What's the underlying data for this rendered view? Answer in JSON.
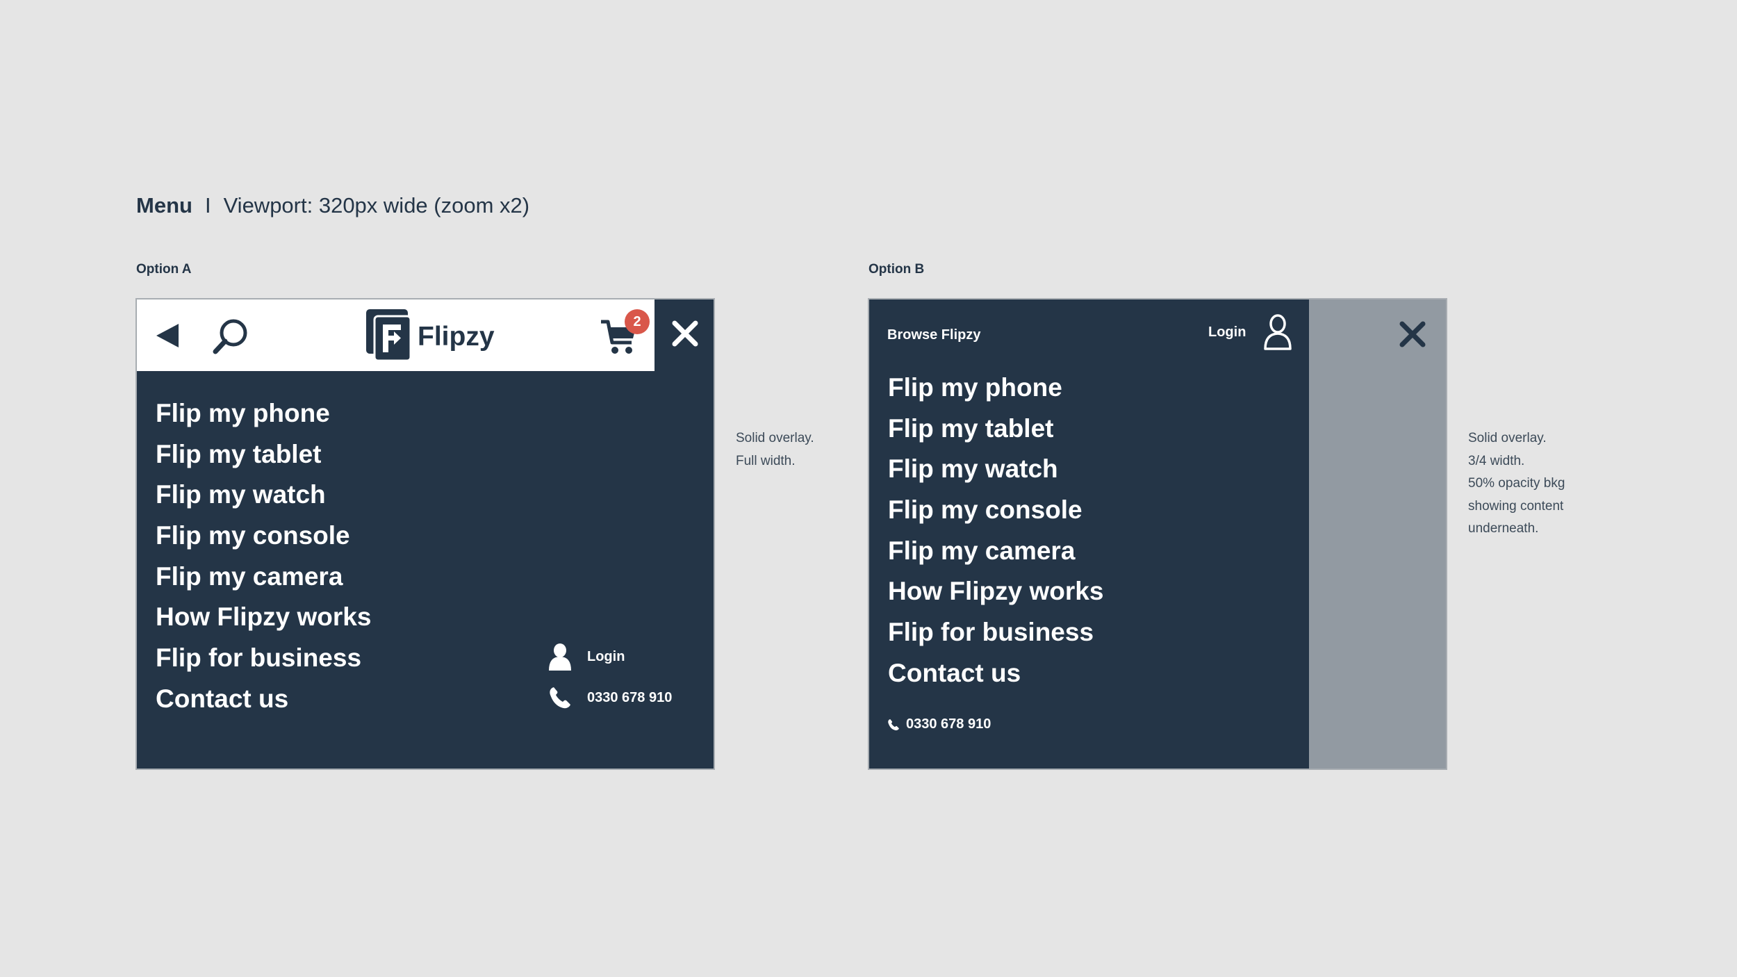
{
  "heading": {
    "title": "Menu",
    "separator": "I",
    "subtitle": "Viewport: 320px wide (zoom x2)"
  },
  "option_a": {
    "label": "Option A",
    "logo_text": "Flipzy",
    "cart_count": "2",
    "menu_items": [
      "Flip my phone",
      "Flip my tablet",
      "Flip my watch",
      "Flip my console",
      "Flip my camera",
      "How Flipzy works",
      "Flip for business",
      "Contact us"
    ],
    "login_label": "Login",
    "phone_number": "0330 678 910",
    "note": [
      "Solid overlay.",
      "Full width."
    ]
  },
  "option_b": {
    "label": "Option B",
    "browse_label": "Browse Flipzy",
    "login_label": "Login",
    "menu_items": [
      "Flip my phone",
      "Flip my tablet",
      "Flip my watch",
      "Flip my console",
      "Flip my camera",
      "How Flipzy works",
      "Flip for business",
      "Contact us"
    ],
    "phone_number": "0330 678 910",
    "note": [
      "Solid overlay.",
      "3/4 width.",
      "50% opacity bkg",
      "showing content",
      "underneath."
    ]
  },
  "icons": {
    "back": "back-arrow-icon",
    "search": "search-icon",
    "cart": "cart-icon",
    "close": "close-icon",
    "user": "user-icon",
    "phone": "phone-icon",
    "logo": "flipzy-logo-icon"
  },
  "colors": {
    "background": "#e5e5e5",
    "navy": "#243547",
    "overlay_grey": "#929aa2",
    "badge_red": "#d9574a",
    "white": "#ffffff"
  }
}
